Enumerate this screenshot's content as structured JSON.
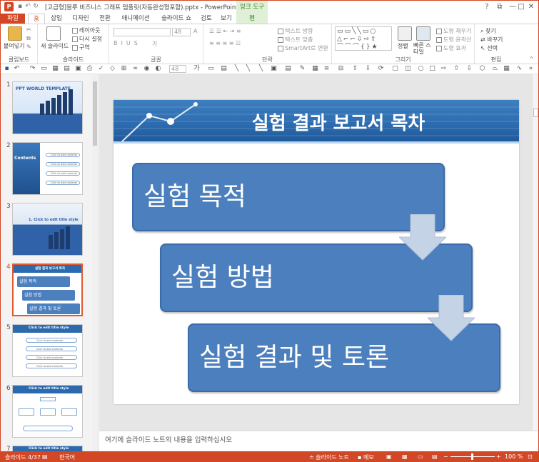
{
  "window": {
    "title": "[고급형]블루 비즈니스 그래프 템플릿(자동완성형포함).pptx - PowerPoint",
    "context_title": "잉크 도구",
    "controls": {
      "help": "?",
      "restore": "⧉",
      "minimize": "—",
      "maximize": "□",
      "close": "✕"
    }
  },
  "tabs": [
    "파일",
    "홈",
    "삽입",
    "디자인",
    "전환",
    "애니메이션",
    "슬라이드 쇼",
    "검토",
    "보기",
    "펜"
  ],
  "ribbon": {
    "clipboard": {
      "paste": "붙여넣기",
      "label": "클립보드"
    },
    "slides": {
      "new_slide": "새 슬라이드",
      "layout": "레이아웃",
      "reset": "다시 설정",
      "section": "구역",
      "label": "슬라이드"
    },
    "font": {
      "size": "48",
      "label": "글꼴"
    },
    "paragraph": {
      "text_direction": "텍스트 방향",
      "align_text": "텍스트 맞춤",
      "smartart": "SmartArt로 변환",
      "label": "단락"
    },
    "drawing": {
      "arrange": "정렬",
      "quick_styles": "빠른 스타일",
      "shape_fill": "도형 채우기",
      "shape_outline": "도형 윤곽선",
      "shape_effects": "도형 효과",
      "label": "그리기"
    },
    "editing": {
      "find": "찾기",
      "replace": "바꾸기",
      "select": "선택",
      "label": "편집"
    }
  },
  "quickbar": {
    "font_size": "48"
  },
  "thumbnails": [
    {
      "num": "1",
      "title": "PPT WORLD TEMPLATE"
    },
    {
      "num": "2",
      "title": "Contents",
      "items": [
        "Click to add contents",
        "Click to add contents",
        "Click to add contents",
        "Click to add contents"
      ]
    },
    {
      "num": "3",
      "title": "1. Click to edit title style"
    },
    {
      "num": "4",
      "title": "실험 결과 보고서 목차",
      "items": [
        "실험 목적",
        "실험 방법",
        "실험 결과 및 토론"
      ]
    },
    {
      "num": "5",
      "title": "Click to edit title style",
      "items": [
        "Click to add contents",
        "Click to add contents",
        "Click to add contents",
        "Click to add contents"
      ]
    },
    {
      "num": "6",
      "title": "Click to edit title style"
    },
    {
      "num": "7",
      "title": "Click to edit title style"
    }
  ],
  "slide": {
    "title": "실험 결과 보고서 목차",
    "items": [
      "실험 목적",
      "실험 방법",
      "실험 결과 및 토론"
    ]
  },
  "notes": {
    "placeholder": "여기에 슬라이드 노트의 내용을 입력하십시오"
  },
  "status": {
    "slide": "슬라이드 4/37",
    "language": "한국어",
    "notes_button": "슬라이드 노트",
    "comments_button": "메모",
    "zoom": "100 %"
  },
  "colors": {
    "accent": "#d24726",
    "slide_box": "#4c7fbe",
    "header": "#2b6aae"
  }
}
